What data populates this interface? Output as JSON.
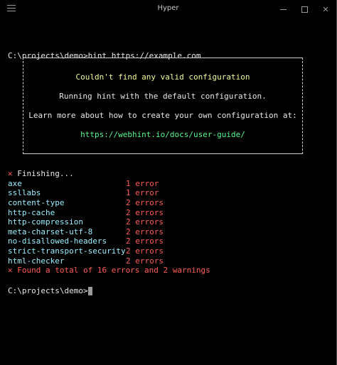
{
  "window": {
    "title": "Hyper"
  },
  "terminal": {
    "command_line": "C:\\projects\\demo>hint https://example.com",
    "box": {
      "line1": "Couldn't find any valid configuration",
      "line2": "Running hint with the default configuration.",
      "line3": "Learn more about how to create your own configuration at:",
      "link": "https://webhint.io/docs/user-guide/"
    },
    "finishing": "✕ Finishing...",
    "results": [
      {
        "name": "axe",
        "count": "1 error"
      },
      {
        "name": "ssllabs",
        "count": "1 error"
      },
      {
        "name": "content-type",
        "count": "2 errors"
      },
      {
        "name": "http-cache",
        "count": "2 errors"
      },
      {
        "name": "http-compression",
        "count": "2 errors"
      },
      {
        "name": "meta-charset-utf-8",
        "count": "2 errors"
      },
      {
        "name": "no-disallowed-headers",
        "count": "2 errors"
      },
      {
        "name": "strict-transport-security",
        "count": "2 errors"
      },
      {
        "name": "html-checker",
        "count": "2 errors"
      }
    ],
    "summary": "✕ Found a total of 16 errors and 2 warnings",
    "prompt": "C:\\projects\\demo>"
  },
  "colors": {
    "background": "#000000",
    "error_red": "#ff5c57",
    "rule_cyan": "#9aedfe",
    "heading_yellow": "#f3f99d",
    "link_green": "#5af78e"
  },
  "icons": [
    "hamburger-menu-icon",
    "minimize-icon",
    "maximize-icon",
    "close-icon"
  ]
}
